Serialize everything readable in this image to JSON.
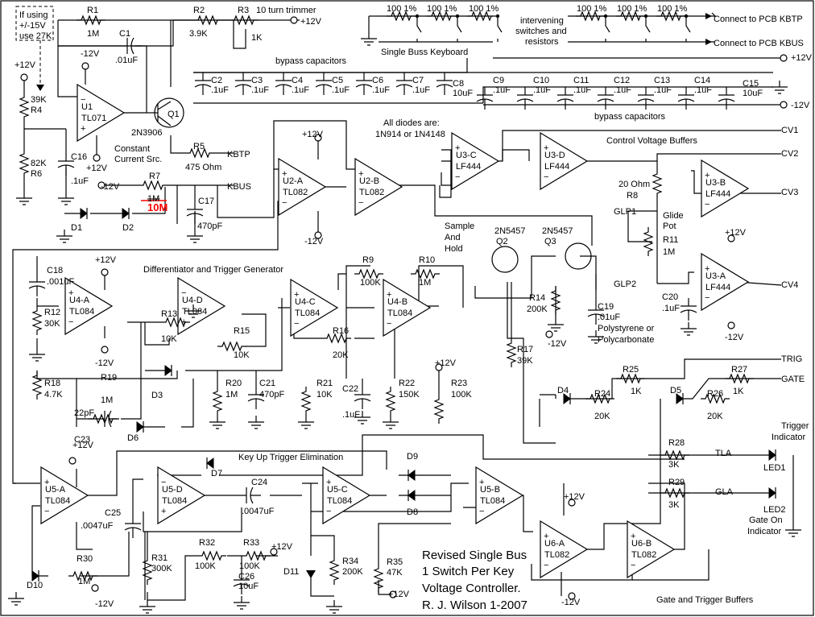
{
  "note_box": {
    "line1": "If using",
    "line2": "+/-15V",
    "line3": "use 27K"
  },
  "title_block": {
    "line1": "Revised Single Bus",
    "line2": "1 Switch Per Key",
    "line3": "Voltage Controller.",
    "line4": "R. J. Wilson 1-2007"
  },
  "annotations": {
    "trimmer": "10 turn trimmer",
    "bypass_top": "bypass capacitors",
    "bypass_bottom": "bypass capacitors",
    "keyboard": "Single Buss Keyboard",
    "intervening1": "intervening",
    "intervening2": "switches and",
    "intervening3": "resistors",
    "kbtp_out": "Connect to PCB KBTP",
    "kbus_out": "Connect to PCB KBUS",
    "diodes1": "All diodes are:",
    "diodes2": "1N914 or 1N4148",
    "cv_buffers": "Control Voltage Buffers",
    "ccs1": "Constant",
    "ccs2": "Current Src.",
    "diff": "Differentiator and Trigger Generator",
    "sah1": "Sample",
    "sah2": "And",
    "sah3": "Hold",
    "poly1": "Polystyrene or",
    "poly2": "Polycarbonate",
    "glide1": "Glide",
    "glide2": "Pot",
    "keyup": "Key Up Trigger Elimination",
    "gate_buffers": "Gate and Trigger Buffers",
    "trig_ind1": "Trigger",
    "trig_ind2": "Indicator",
    "gate_ind1": "Gate On",
    "gate_ind2": "Indicator"
  },
  "nets": {
    "p12": "+12V",
    "m12": "-12V",
    "kbtp": "KBTP",
    "kbus": "KBUS",
    "cv1": "CV1",
    "cv2": "CV2",
    "cv3": "CV3",
    "cv4": "CV4",
    "glp1": "GLP1",
    "glp2": "GLP2",
    "trig": "TRIG",
    "gate": "GATE",
    "tla": "TLA",
    "gla": "GLA"
  },
  "keyboard_resistor": "100 1%",
  "opamps": {
    "U1": [
      "U1",
      "TL071"
    ],
    "U2A": [
      "U2-A",
      "TL082"
    ],
    "U2B": [
      "U2-B",
      "TL082"
    ],
    "U3C": [
      "U3-C",
      "LF444"
    ],
    "U3D": [
      "U3-D",
      "LF444"
    ],
    "U3B": [
      "U3-B",
      "LF444"
    ],
    "U3A": [
      "U3-A",
      "LF444"
    ],
    "U4A": [
      "U4-A",
      "TL084"
    ],
    "U4D": [
      "U4-D",
      "TL084"
    ],
    "U4C": [
      "U4-C",
      "TL084"
    ],
    "U4B": [
      "U4-B",
      "TL084"
    ],
    "U5A": [
      "U5-A",
      "TL084"
    ],
    "U5D": [
      "U5-D",
      "TL084"
    ],
    "U5C": [
      "U5-C",
      "TL084"
    ],
    "U5B": [
      "U5-B",
      "TL084"
    ],
    "U6A": [
      "U6-A",
      "TL082"
    ],
    "U6B": [
      "U6-B",
      "TL082"
    ]
  },
  "components": {
    "R1": [
      "R1",
      "1M"
    ],
    "R2": [
      "R2",
      "3.9K"
    ],
    "R3": [
      "R3",
      "1K"
    ],
    "R4": [
      "R4",
      "39K"
    ],
    "R5": [
      "R5",
      "475 Ohm"
    ],
    "R6": [
      "R6",
      "82K"
    ],
    "R7": [
      "R7",
      "1M"
    ],
    "R7_new": "10M",
    "R8": [
      "R8",
      "20 Ohm"
    ],
    "R9": [
      "R9",
      "100K"
    ],
    "R10": [
      "R10",
      "1M"
    ],
    "R11": [
      "R11",
      "1M"
    ],
    "R12": [
      "R12",
      "30K"
    ],
    "R13": [
      "R13",
      "10K"
    ],
    "R14": [
      "R14",
      "200K"
    ],
    "R15": [
      "R15",
      "10K"
    ],
    "R16": [
      "R16",
      "20K"
    ],
    "R17": [
      "R17",
      "39K"
    ],
    "R18": [
      "R18",
      "4.7K"
    ],
    "R19": [
      "R19",
      "1M"
    ],
    "R20": [
      "R20",
      "1M"
    ],
    "R21": [
      "R21",
      "10K"
    ],
    "R22": [
      "R22",
      "150K"
    ],
    "R23": [
      "R23",
      "100K"
    ],
    "R24": [
      "R24",
      "20K"
    ],
    "R25": [
      "R25",
      "1K"
    ],
    "R26": [
      "R26",
      "20K"
    ],
    "R27": [
      "R27",
      "1K"
    ],
    "R28": [
      "R28",
      "3K"
    ],
    "R29": [
      "R29",
      "3K"
    ],
    "R30": [
      "R30",
      "1M"
    ],
    "R31": [
      "R31",
      "300K"
    ],
    "R32": [
      "R32",
      "100K"
    ],
    "R33": [
      "R33",
      "100K"
    ],
    "R34": [
      "R34",
      "200K"
    ],
    "R35": [
      "R35",
      "47K"
    ],
    "C1": [
      "C1",
      ".01uF"
    ],
    "C2": [
      "C2",
      ".1uF"
    ],
    "C3": [
      "C3",
      ".1uF"
    ],
    "C4": [
      "C4",
      ".1uF"
    ],
    "C5": [
      "C5",
      ".1uF"
    ],
    "C6": [
      "C6",
      ".1uF"
    ],
    "C7": [
      "C7",
      ".1uF"
    ],
    "C8": [
      "C8",
      "10uF"
    ],
    "C9": [
      "C9",
      ".1uF"
    ],
    "C10": [
      "C10",
      ".1uF"
    ],
    "C11": [
      "C11",
      ".1uF"
    ],
    "C12": [
      "C12",
      ".1uF"
    ],
    "C13": [
      "C13",
      ".1uF"
    ],
    "C14": [
      "C14",
      ".1uF"
    ],
    "C15": [
      "C15",
      "10uF"
    ],
    "C16": [
      "C16",
      ".1uF"
    ],
    "C17": [
      "C17",
      "470pF"
    ],
    "C18": [
      "C18",
      ".001uF"
    ],
    "C19": [
      "C19",
      ".01uF"
    ],
    "C20": [
      "C20",
      ".1uF"
    ],
    "C21": [
      "C21",
      "470pF"
    ],
    "C22": [
      "C22",
      ".1uF"
    ],
    "C23": [
      "C23",
      "22pF"
    ],
    "C24": [
      "C24",
      ".0047uF"
    ],
    "C25": [
      "C25",
      ".0047uF"
    ],
    "C26": [
      "C26",
      "10uF"
    ],
    "Q1": [
      "Q1",
      "2N3906"
    ],
    "Q2": [
      "Q2",
      "2N5457"
    ],
    "Q3": [
      "Q3",
      "2N5457"
    ],
    "D1": "D1",
    "D2": "D2",
    "D3": "D3",
    "D4": "D4",
    "D5": "D5",
    "D6": "D6",
    "D7": "D7",
    "D8": "D8",
    "D9": "D9",
    "D10": "D10",
    "D11": "D11",
    "LED1": "LED1",
    "LED2": "LED2"
  },
  "colors": {
    "line": "#000000",
    "correction": "#ff0000",
    "background": "#ffffff"
  }
}
